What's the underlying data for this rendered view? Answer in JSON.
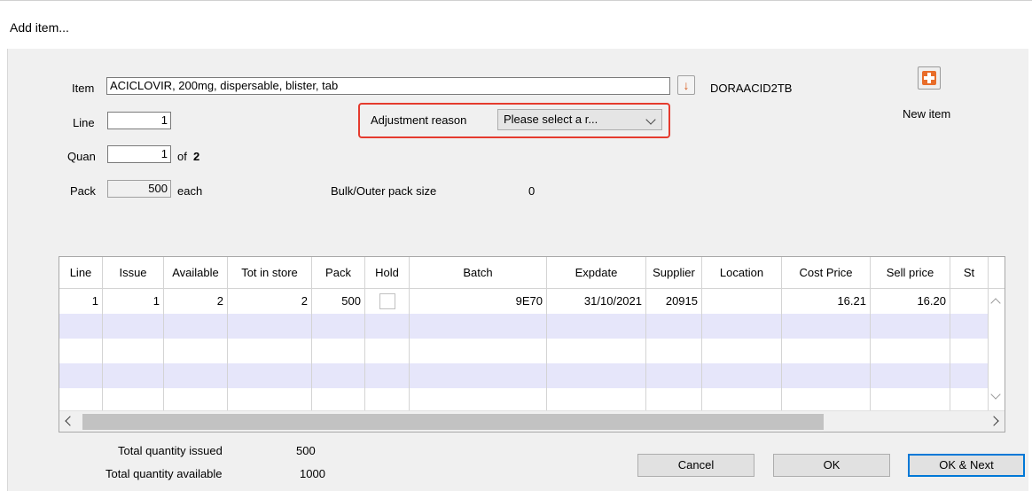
{
  "window": {
    "title": "Add item..."
  },
  "item": {
    "label": "Item",
    "value": "ACICLOVIR, 200mg, dispersable, blister, tab",
    "code": "DORAACID2TB"
  },
  "line": {
    "label": "Line",
    "value": "1"
  },
  "quan": {
    "label": "Quan",
    "value": "1",
    "of_label": "of",
    "of_value": "2"
  },
  "pack": {
    "label": "Pack",
    "value": "500",
    "unit": "each"
  },
  "adjustment": {
    "label": "Adjustment reason",
    "selected": "Please select a r..."
  },
  "bulk": {
    "label": "Bulk/Outer pack size",
    "value": "0"
  },
  "new_item": {
    "label": "New item"
  },
  "table": {
    "columns": [
      "Line",
      "Issue",
      "Available",
      "Tot in store",
      "Pack",
      "Hold",
      "Batch",
      "Expdate",
      "Supplier",
      "Location",
      "Cost Price",
      "Sell price",
      "St"
    ],
    "rows": [
      {
        "line": "1",
        "issue": "1",
        "available": "2",
        "tot": "2",
        "pack": "500",
        "hold": false,
        "batch": "9E70",
        "expdate": "31/10/2021",
        "supplier": "20915",
        "location": "",
        "cost": "16.21",
        "sell": "16.20",
        "st": ""
      }
    ]
  },
  "totals": {
    "issued_label": "Total quantity issued",
    "issued_value": "500",
    "available_label": "Total quantity available",
    "available_value": "1000"
  },
  "buttons": {
    "cancel": "Cancel",
    "ok": "OK",
    "ok_next": "OK & Next"
  },
  "colors": {
    "highlight": "#e53b2e",
    "alt_row": "#e6e6fa",
    "default_button_border": "#0078d7"
  }
}
